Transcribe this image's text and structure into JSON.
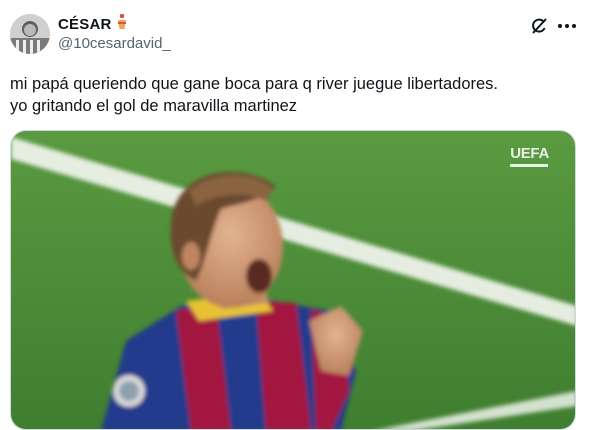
{
  "tweet": {
    "display_name": "CÉSAR",
    "handle": "@10cesardavid_",
    "text_line1": "mi papá queriendo que gane boca para q river juegue libertadores.",
    "text_line2": "yo gritando el gol de maravilla martinez"
  },
  "media": {
    "watermark": "UEFA"
  },
  "icons": {
    "avatar": "user-avatar",
    "badge": "emoji-badge-icon",
    "grok": "grok-icon",
    "more": "more-options-icon"
  },
  "colors": {
    "text": "#0f1419",
    "muted": "#536471",
    "pitch": "#4f8f3a"
  }
}
